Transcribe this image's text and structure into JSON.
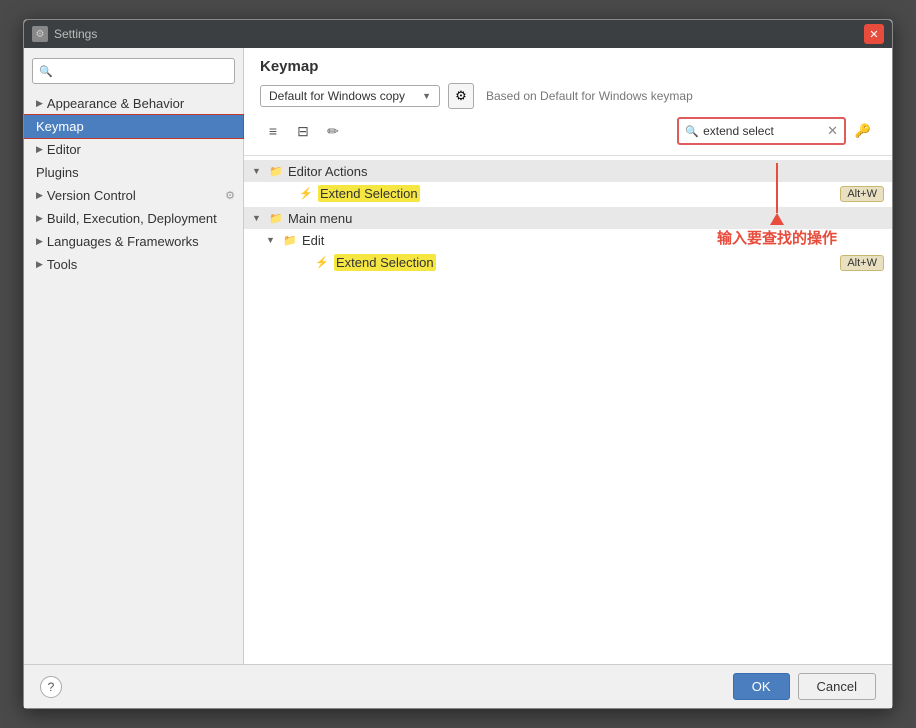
{
  "window": {
    "title": "Settings",
    "icon": "⚙"
  },
  "sidebar": {
    "search_placeholder": "🔍",
    "items": [
      {
        "id": "appearance",
        "label": "Appearance & Behavior",
        "has_chevron": true,
        "indent": 0
      },
      {
        "id": "keymap",
        "label": "Keymap",
        "has_chevron": false,
        "indent": 0,
        "selected": true
      },
      {
        "id": "editor",
        "label": "Editor",
        "has_chevron": true,
        "indent": 0
      },
      {
        "id": "plugins",
        "label": "Plugins",
        "has_chevron": false,
        "indent": 0
      },
      {
        "id": "vcs",
        "label": "Version Control",
        "has_chevron": true,
        "indent": 0,
        "has_gear": true
      },
      {
        "id": "build",
        "label": "Build, Execution, Deployment",
        "has_chevron": true,
        "indent": 0
      },
      {
        "id": "languages",
        "label": "Languages & Frameworks",
        "has_chevron": true,
        "indent": 0
      },
      {
        "id": "tools",
        "label": "Tools",
        "has_chevron": true,
        "indent": 0
      }
    ]
  },
  "panel": {
    "title": "Keymap",
    "keymap_dropdown_label": "Default for Windows copy",
    "based_on_text": "Based on Default for Windows keymap",
    "search_value": "extend select",
    "search_placeholder": "extend select"
  },
  "tree": {
    "sections": [
      {
        "id": "editor-actions",
        "label": "Editor Actions",
        "expanded": true,
        "items": [
          {
            "id": "extend-selection-1",
            "label": "Extend Selection",
            "shortcut": "Alt+W"
          }
        ]
      },
      {
        "id": "main-menu",
        "label": "Main menu",
        "expanded": true,
        "items": [
          {
            "id": "edit-group",
            "label": "Edit",
            "is_subgroup": true,
            "items": [
              {
                "id": "extend-selection-2",
                "label": "Extend Selection",
                "shortcut": "Alt+W"
              }
            ]
          }
        ]
      }
    ]
  },
  "annotation": {
    "text": "输入要查找的操作"
  },
  "bottom": {
    "help_label": "?",
    "ok_label": "OK",
    "cancel_label": "Cancel"
  }
}
